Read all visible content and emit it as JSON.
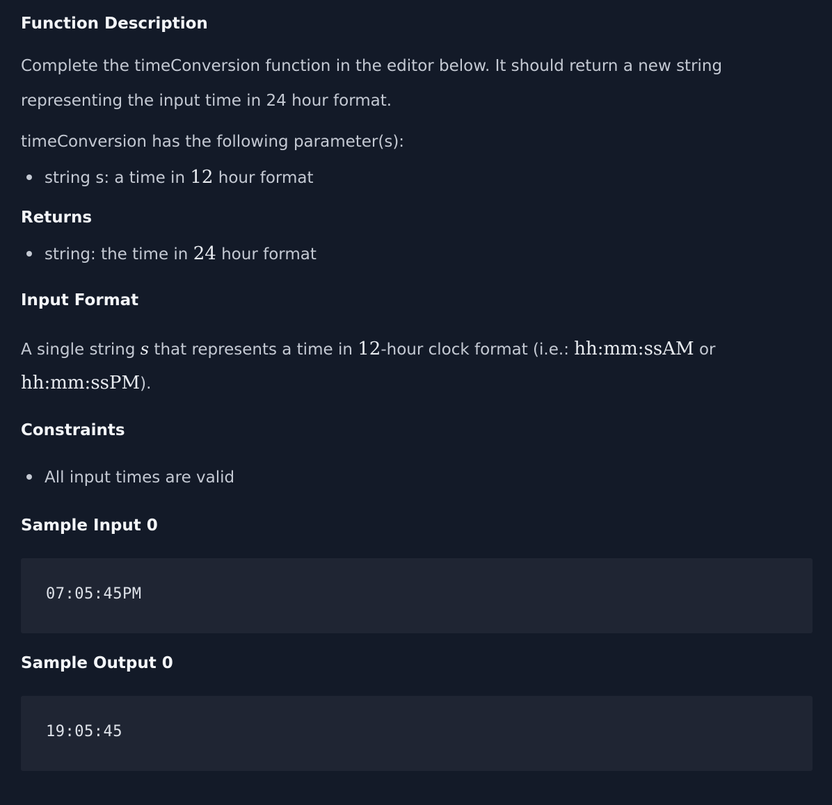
{
  "function_description": {
    "heading": "Function Description",
    "line1": "Complete the timeConversion function in the editor below. It should return a new string",
    "line2": "representing the input time in 24 hour format."
  },
  "parameters": {
    "intro": "timeConversion has the following parameter(s):",
    "item_prefix": "string s: a time in ",
    "item_number": "12",
    "item_suffix": " hour format"
  },
  "returns": {
    "heading": "Returns",
    "item_prefix": "string: the time in ",
    "item_number": "24",
    "item_suffix": " hour format"
  },
  "input_format": {
    "heading": "Input Format",
    "text_a": "A single string ",
    "var": "s",
    "text_b": " that represents a time in ",
    "number": "12",
    "text_c": "-hour clock format (i.e.: ",
    "format_am": "hh:mm:ssAM",
    "text_d": " or",
    "format_pm": "hh:mm:ssPM",
    "text_e": ")."
  },
  "constraints": {
    "heading": "Constraints",
    "item": "All input times are valid"
  },
  "sample_input": {
    "heading": "Sample Input 0",
    "code": "07:05:45PM"
  },
  "sample_output": {
    "heading": "Sample Output 0",
    "code": "19:05:45"
  }
}
